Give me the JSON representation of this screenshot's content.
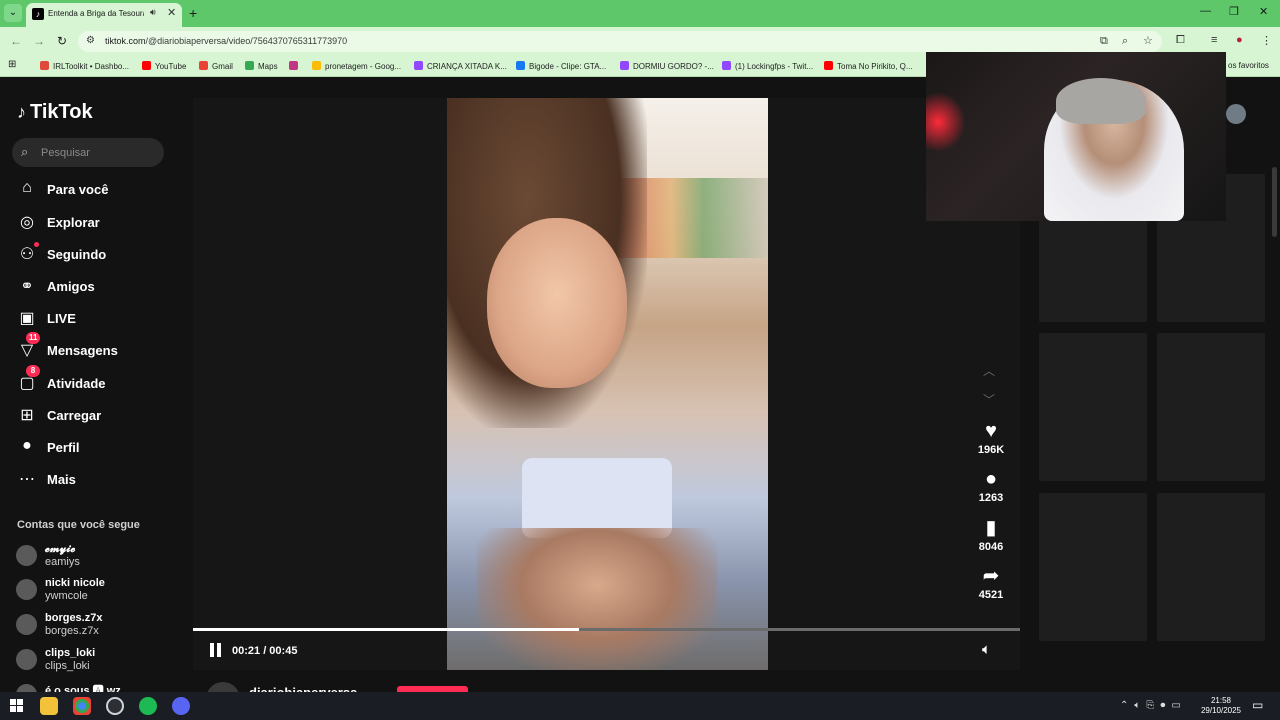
{
  "browser": {
    "tab_title": "Entenda a Briga da Tesoura",
    "url_host": "tiktok.com",
    "url_path": "/@diariobiaperversa/video/7564370765311773970",
    "bookmarks": [
      {
        "label": "IRLToolkit • Dashbo...",
        "color": "#e04a3a"
      },
      {
        "label": "YouTube",
        "color": "#ff0000"
      },
      {
        "label": "Gmail",
        "color": "#ea4335"
      },
      {
        "label": "Maps",
        "color": "#34a853"
      },
      {
        "label": "",
        "color": "#c13584"
      },
      {
        "label": "pronetagem - Goog...",
        "color": "#fbbc04"
      },
      {
        "label": "CRIANÇA XITADA K...",
        "color": "#9146ff"
      },
      {
        "label": "Bigode - Clipe: GTA...",
        "color": "#1877f2"
      },
      {
        "label": "DORMIU GORDO? -...",
        "color": "#9146ff"
      },
      {
        "label": "(1) Lockingfps - Twit...",
        "color": "#9146ff"
      },
      {
        "label": "Toma No Pirikito, Q...",
        "color": "#ff0000"
      }
    ],
    "favorites_label": "os favoritos"
  },
  "tiktok": {
    "logo": "TikTok",
    "search_placeholder": "Pesquisar",
    "nav": [
      {
        "label": "Para você",
        "icon": "home-icon"
      },
      {
        "label": "Explorar",
        "icon": "compass-icon"
      },
      {
        "label": "Seguindo",
        "icon": "following-icon"
      },
      {
        "label": "Amigos",
        "icon": "friends-icon"
      },
      {
        "label": "LIVE",
        "icon": "live-icon"
      },
      {
        "label": "Mensagens",
        "icon": "messages-icon",
        "badge": "11"
      },
      {
        "label": "Atividade",
        "icon": "activity-icon",
        "badge": "8"
      },
      {
        "label": "Carregar",
        "icon": "upload-icon"
      },
      {
        "label": "Perfil",
        "icon": "profile-icon"
      },
      {
        "label": "Mais",
        "icon": "more-icon"
      }
    ],
    "following_heading": "Contas que você segue",
    "following": [
      {
        "name": "𝓮𝓶𝔂𝓲𝓮",
        "handle": "eamiys"
      },
      {
        "name": "nicki nicole",
        "handle": "ywmcole"
      },
      {
        "name": "borges.z7x",
        "handle": "borges.z7x"
      },
      {
        "name": "clips_loki",
        "handle": "clips_loki"
      },
      {
        "name": "é o sous 🅰 wz",
        "handle": ""
      }
    ],
    "video": {
      "time": "00:21 / 00:45",
      "progress": 0.4667,
      "author": "diariobiaperversa"
    },
    "actions": [
      {
        "icon": "heart-icon",
        "count": "196K"
      },
      {
        "icon": "comment-icon",
        "count": "1263"
      },
      {
        "icon": "bookmark-icon",
        "count": "8046"
      },
      {
        "icon": "share-icon",
        "count": "4521"
      }
    ]
  },
  "taskbar": {
    "time": "21:58",
    "date": "29/10/2025"
  }
}
